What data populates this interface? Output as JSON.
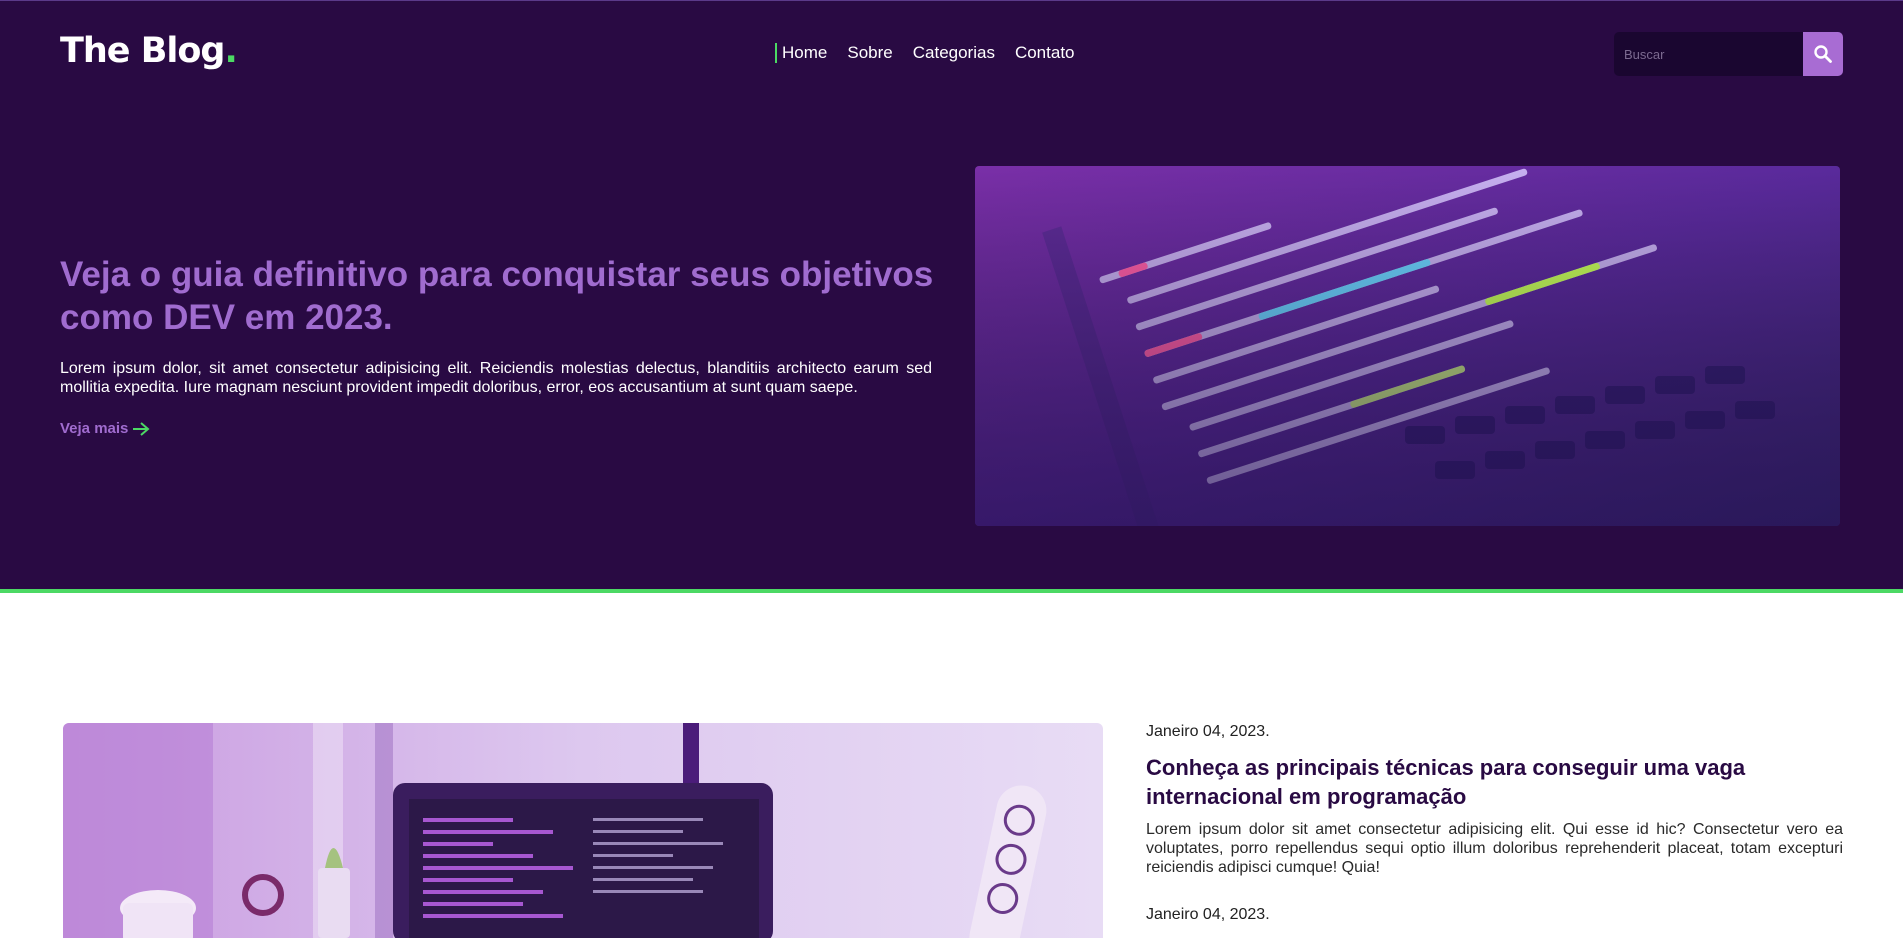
{
  "brand": {
    "name": "The Blog",
    "dot": "."
  },
  "nav": [
    {
      "label": "Home"
    },
    {
      "label": "Sobre"
    },
    {
      "label": "Categorias"
    },
    {
      "label": "Contato"
    }
  ],
  "search": {
    "placeholder": "Buscar",
    "icon": "search-icon"
  },
  "hero": {
    "title": "Veja o guia definitivo para conquistar seus objetivos como DEV em 2023.",
    "text": "Lorem ipsum dolor, sit amet consectetur adipisicing elit. Reiciendis molestias delectus, blanditiis architecto earum sed mollitia expedita. Iure magnam nesciunt provident impedit doloribus, error, eos accusantium at sunt quam saepe.",
    "link_label": "Veja mais",
    "link_icon": "arrow-right-icon"
  },
  "posts": [
    {
      "date": "Janeiro 04, 2023.",
      "title": "Conheça as principais técnicas para conseguir uma vaga internacional em programação",
      "text": "Lorem ipsum dolor sit amet consectetur adipisicing elit. Qui esse id hic? Consectetur vero ea voluptates, porro repellendus sequi optio illum doloribus reprehenderit placeat, totam excepturi reiciendis adipisci cumque! Quia!"
    },
    {
      "date": "Janeiro 04, 2023."
    }
  ],
  "colors": {
    "header_bg": "#290a43",
    "accent_purple": "#a06ccf",
    "accent_green": "#4cd964",
    "search_button": "#a86cd3"
  }
}
